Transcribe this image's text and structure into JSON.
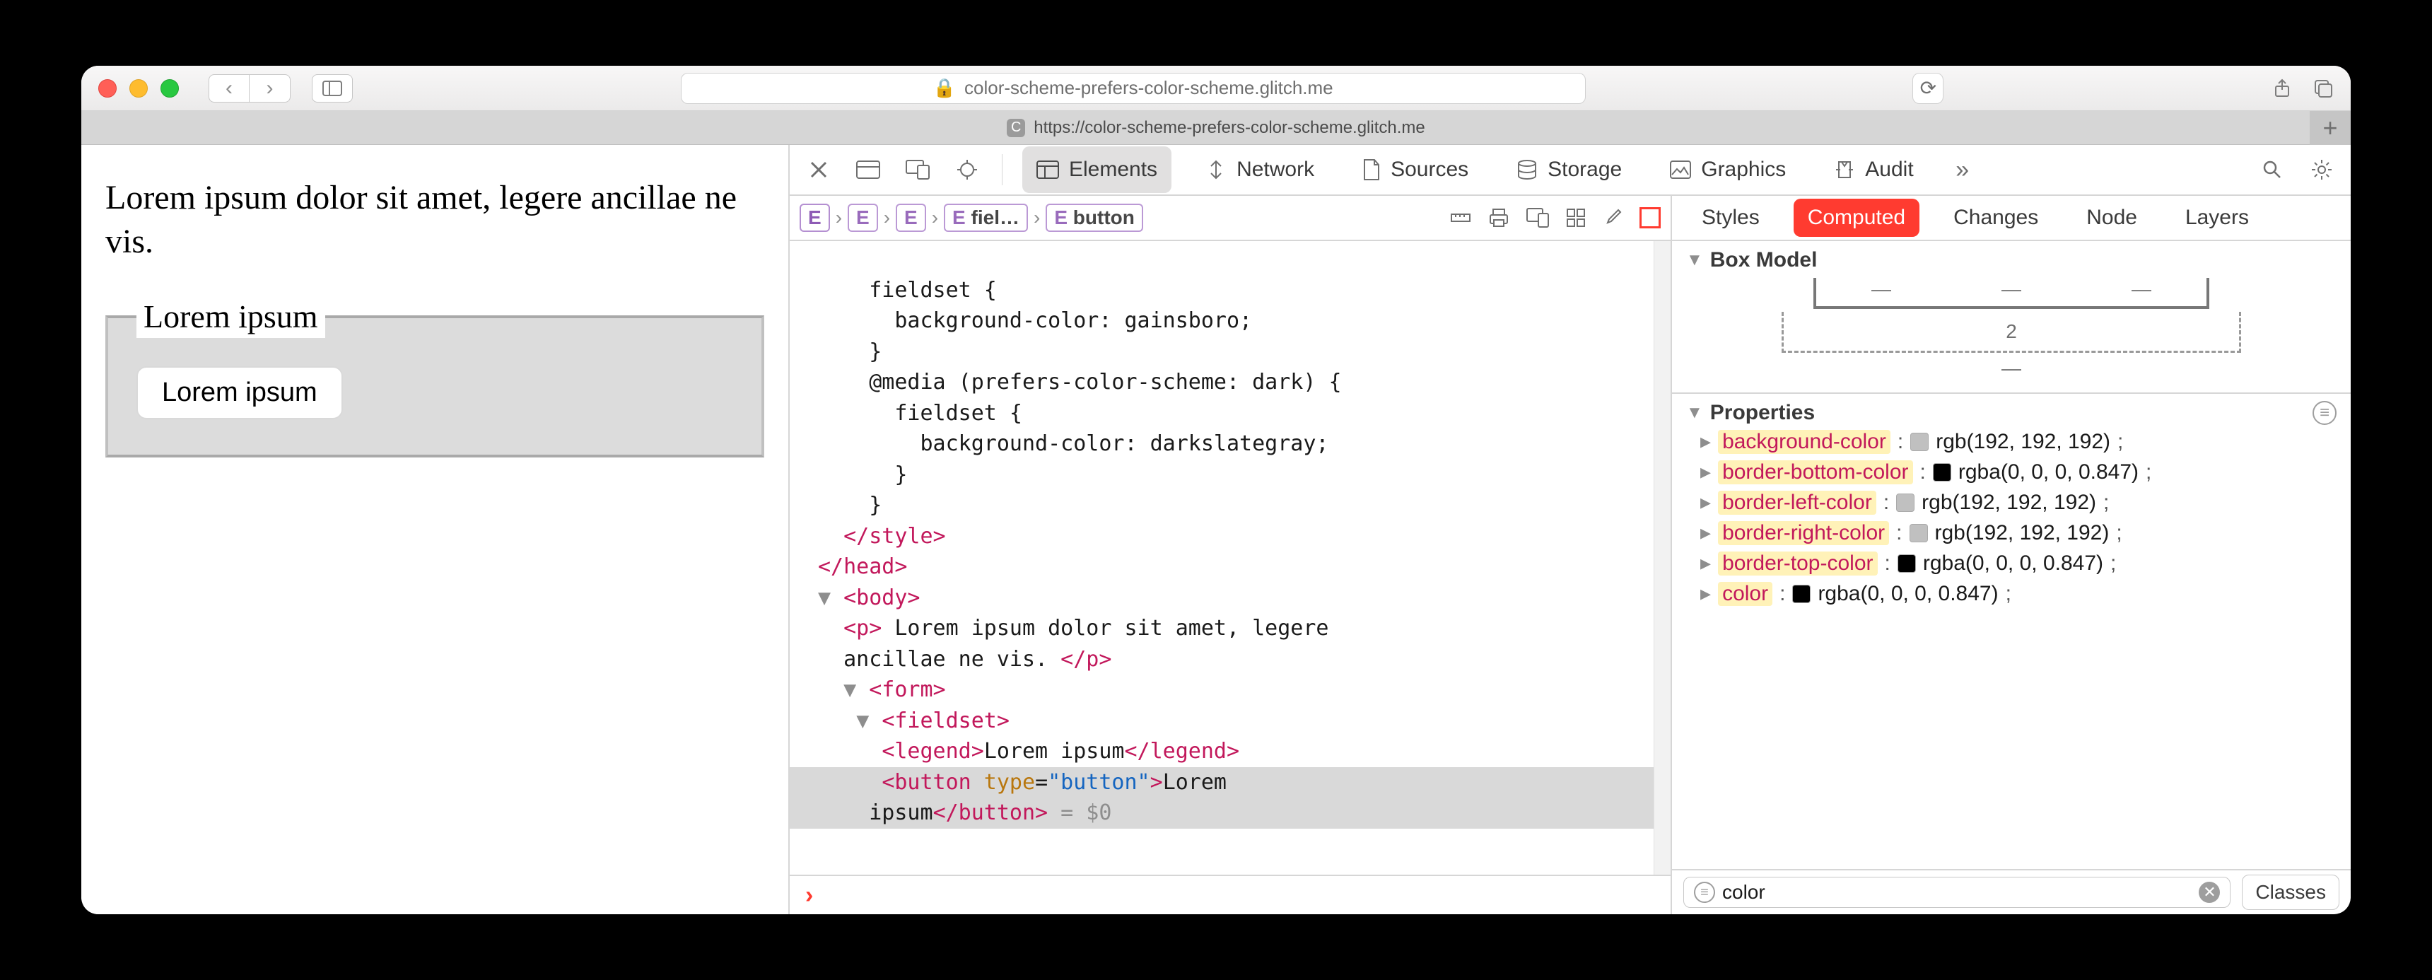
{
  "titlebar": {
    "url_display": "color-scheme-prefers-color-scheme.glitch.me",
    "lock_icon": "lock"
  },
  "tab": {
    "label": "https://color-scheme-prefers-color-scheme.glitch.me"
  },
  "page": {
    "paragraph": "Lorem ipsum dolor sit amet, legere ancillae ne vis.",
    "legend": "Lorem ipsum",
    "button_label": "Lorem ipsum"
  },
  "devtools": {
    "tabs": {
      "elements": "Elements",
      "network": "Network",
      "sources": "Sources",
      "storage": "Storage",
      "graphics": "Graphics",
      "audit": "Audit"
    },
    "breadcrumb": {
      "e0": "E",
      "e1": "E",
      "e2": "E",
      "e3": "fiel…",
      "e4": "button"
    },
    "source": {
      "l1": "    fieldset {",
      "l2": "      background-color: gainsboro;",
      "l3": "    }",
      "l4": "    @media (prefers-color-scheme: dark) {",
      "l5": "      fieldset {",
      "l6": "        background-color: darkslategray;",
      "l7": "      }",
      "l8": "    }",
      "style_close": "</style>",
      "head_close": "</head>",
      "body_open": "<body>",
      "p_text": " Lorem ipsum dolor sit amet, legere \n  ancillae ne vis. ",
      "form_open": "<form>",
      "fieldset_open": "<fieldset>",
      "legend_open": "<legend>",
      "legend_text": "Lorem ipsum",
      "legend_close": "</legend>",
      "button_open": "<button",
      "button_attr": " type",
      "button_val": "\"button\"",
      "button_text": "Lorem \n    ipsum",
      "button_close": "</button>",
      "dollar": " = $0"
    },
    "style_tabs": {
      "styles": "Styles",
      "computed": "Computed",
      "changes": "Changes",
      "node": "Node",
      "layers": "Layers"
    },
    "boxmodel": {
      "title": "Box Model",
      "dash_value": "2",
      "dash_dash": "—"
    },
    "properties": {
      "title": "Properties",
      "rows": [
        {
          "name": "background-color",
          "swatch": "#c0c0c0",
          "value": "rgb(192, 192, 192)"
        },
        {
          "name": "border-bottom-color",
          "swatch": "#000000",
          "value": "rgba(0, 0, 0, 0.847)"
        },
        {
          "name": "border-left-color",
          "swatch": "#c0c0c0",
          "value": "rgb(192, 192, 192)"
        },
        {
          "name": "border-right-color",
          "swatch": "#c0c0c0",
          "value": "rgb(192, 192, 192)"
        },
        {
          "name": "border-top-color",
          "swatch": "#000000",
          "value": "rgba(0, 0, 0, 0.847)"
        },
        {
          "name": "color",
          "swatch": "#000000",
          "value": "rgba(0, 0, 0, 0.847)"
        }
      ]
    },
    "filter": {
      "value": "color",
      "classes_btn": "Classes"
    }
  }
}
